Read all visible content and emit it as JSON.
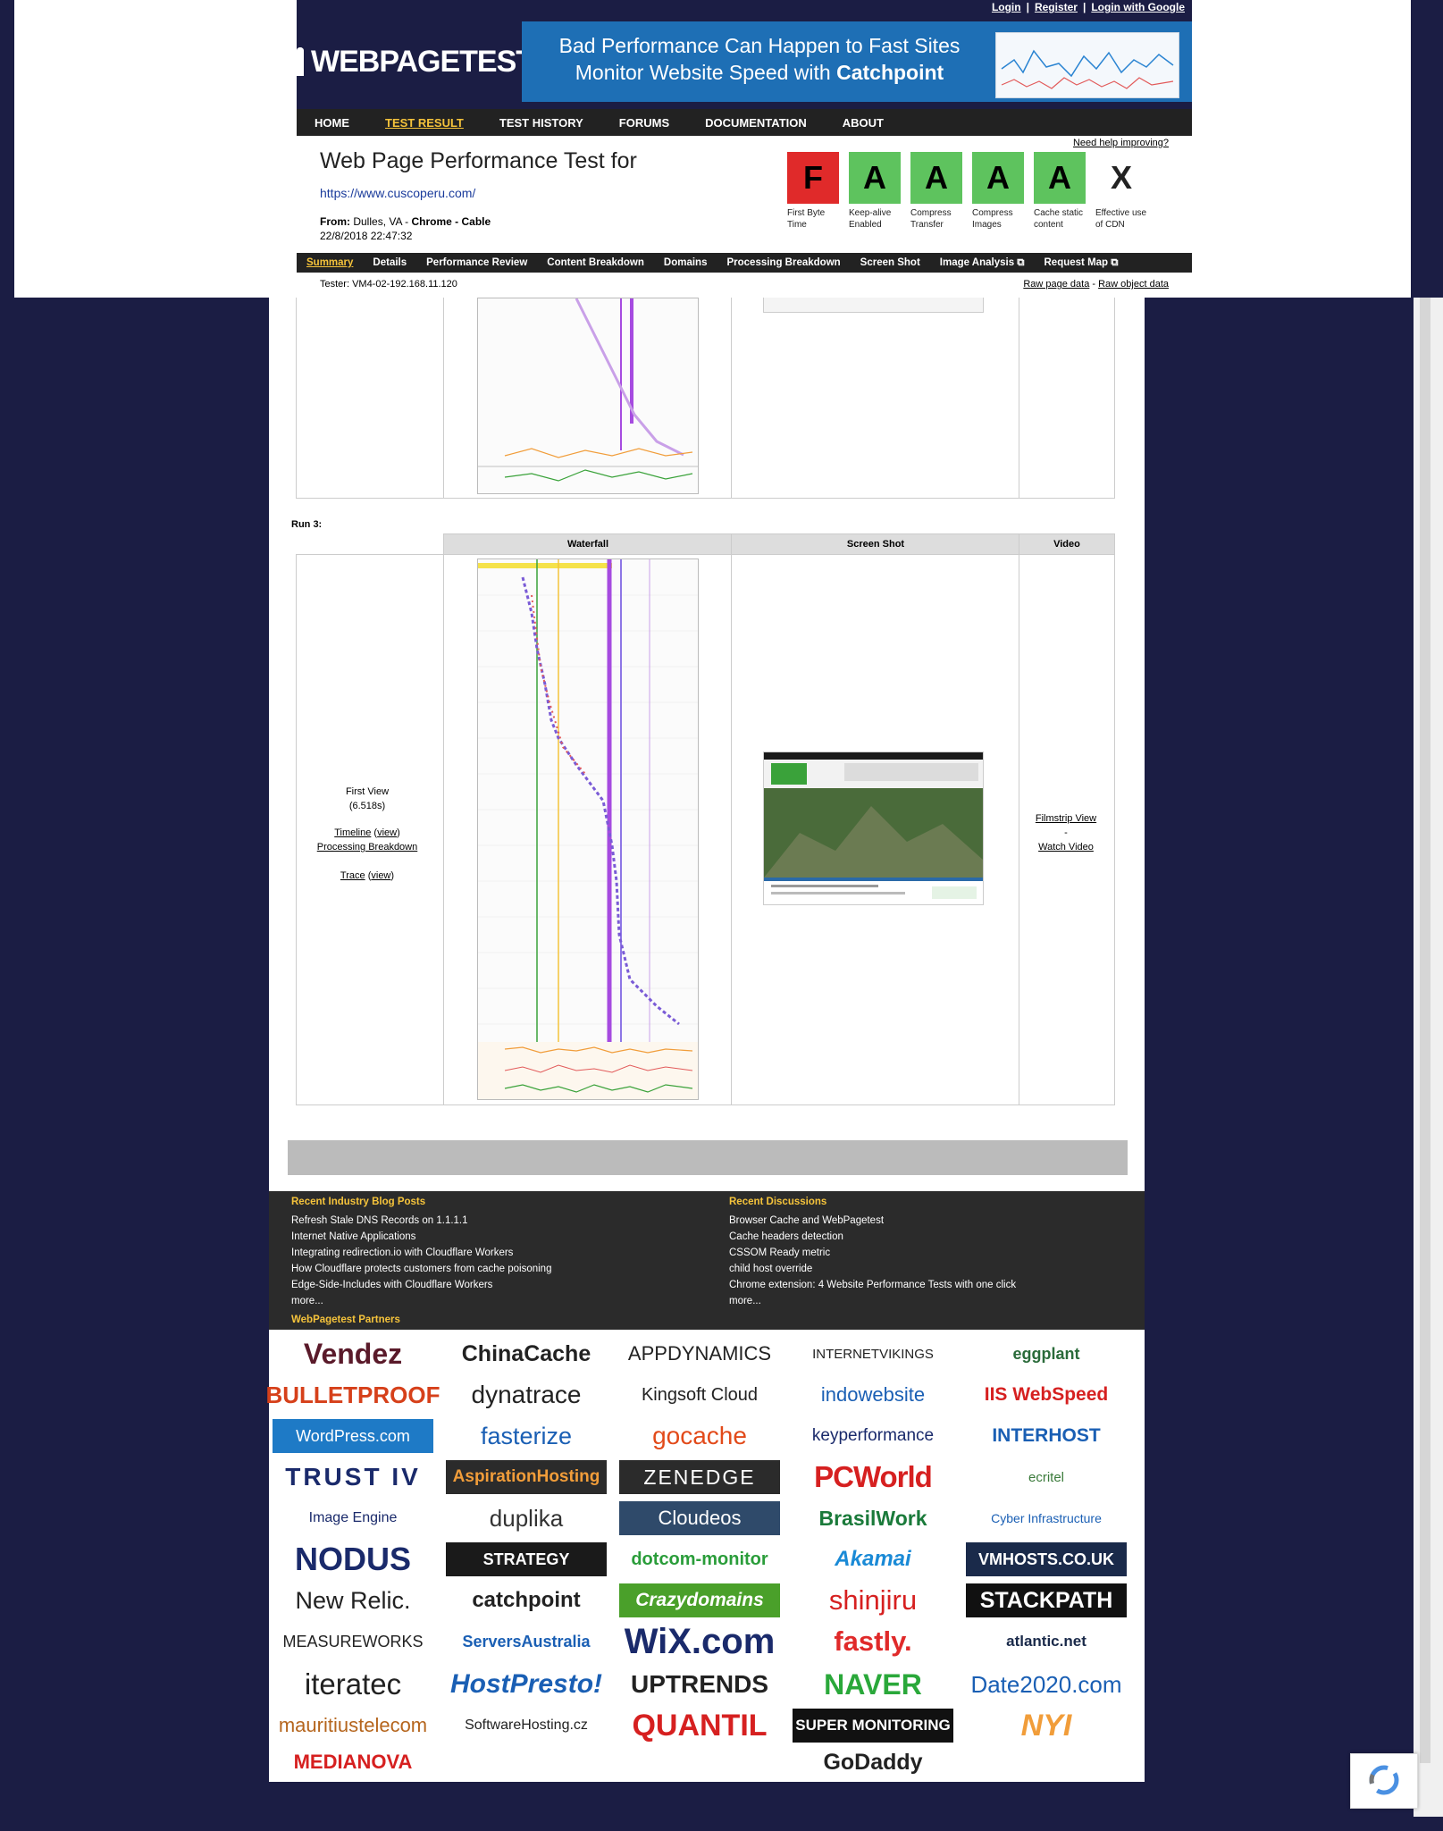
{
  "top_links": {
    "login": "Login",
    "register": "Register",
    "login_google": "Login with Google",
    "sep": "|"
  },
  "logo": {
    "text": "WEBPAGETEST"
  },
  "banner": {
    "line1": "Bad Performance Can Happen to Fast Sites",
    "line2_prefix": "Monitor Website Speed with ",
    "line2_brand": "Catchpoint"
  },
  "menu": [
    "HOME",
    "TEST RESULT",
    "TEST HISTORY",
    "FORUMS",
    "DOCUMENTATION",
    "ABOUT"
  ],
  "header": {
    "title": "Web Page Performance Test for",
    "url": "https://www.cuscoperu.com/",
    "from_label": "From: ",
    "from_loc": "Dulles, VA - ",
    "from_browser": "Chrome - Cable",
    "datetime": "22/8/2018 22:47:32",
    "help": "Need help improving?",
    "tester": "Tester: VM4-02-192.168.11.120",
    "raw_page": "Raw page data",
    "raw_dash": " - ",
    "raw_object": "Raw object data"
  },
  "grades": [
    {
      "grade": "F",
      "label": "First Byte Time",
      "color": "#e02a2a"
    },
    {
      "grade": "A",
      "label": "Keep-alive Enabled",
      "color": "#5ec35e"
    },
    {
      "grade": "A",
      "label": "Compress Transfer",
      "color": "#5ec35e"
    },
    {
      "grade": "A",
      "label": "Compress Images",
      "color": "#5ec35e"
    },
    {
      "grade": "A",
      "label": "Cache static content",
      "color": "#5ec35e"
    },
    {
      "grade": "X",
      "label": "Effective use of CDN",
      "color": "#ffffff"
    }
  ],
  "tabs": [
    "Summary",
    "Details",
    "Performance Review",
    "Content Breakdown",
    "Domains",
    "Processing Breakdown",
    "Screen Shot",
    "Image Analysis ⧉",
    "Request Map ⧉"
  ],
  "run3": {
    "label": "Run 3:",
    "col_waterfall": "Waterfall",
    "col_screenshot": "Screen Shot",
    "col_video": "Video",
    "first_view": "First View",
    "time": "(6.518s)",
    "timeline": "Timeline",
    "view1": "view",
    "processing": "Processing Breakdown",
    "trace": "Trace",
    "view2": "view",
    "filmstrip": "Filmstrip View",
    "dash": "-",
    "watch": "Watch Video"
  },
  "footer": {
    "blog_title": "Recent Industry Blog Posts",
    "blog_items": [
      "Refresh Stale DNS Records on 1.1.1.1",
      "Internet Native Applications",
      "Integrating redirection.io with Cloudflare Workers",
      "How Cloudflare protects customers from cache poisoning",
      "Edge-Side-Includes with Cloudflare Workers",
      "more..."
    ],
    "disc_title": "Recent Discussions",
    "disc_items": [
      "Browser Cache and WebPagetest",
      "Cache headers detection",
      "CSSOM Ready metric",
      "child host override",
      "Chrome extension: 4 Website Performance Tests with one click",
      "more..."
    ],
    "partners_title": "WebPagetest Partners"
  },
  "partners": [
    "Vendez",
    "ChinaCache",
    "APPDYNAMICS",
    "INTERNETVIKINGS",
    "eggplant",
    "BULLETPROOF",
    "dynatrace",
    "Kingsoft Cloud",
    "indowebsite",
    "IIS WebSpeed",
    "WordPress.com",
    "fasterize",
    "gocache",
    "keyperformance",
    "INTERHOST",
    "TRUST IV",
    "AspirationHosting",
    "ZENEDGE",
    "PCWorld",
    "ecritel",
    "Image Engine",
    "duplika",
    "Cloudeos",
    "BrasilWork",
    "Cyber Infrastructure",
    "NODUS",
    "STRATEGY",
    "dotcom-monitor",
    "Akamai",
    "VMHOSTS.CO.UK",
    "New Relic.",
    "catchpoint",
    "Crazydomains",
    "shinjiru",
    "STACKPATH",
    "MEASUREWORKS",
    "ServersAustralia",
    "WiX.com",
    "fastly.",
    "atlantic.net",
    "iteratec",
    "HostPresto!",
    "UPTRENDS",
    "NAVER",
    "Date2020.com",
    "mauritiustelecom",
    "SoftwareHosting.cz",
    "QUANTIL",
    "SUPER MONITORING",
    "NYI",
    "MEDIANOVA",
    "GoDaddy"
  ],
  "partner_colors": {
    "red": "#d62020",
    "blue": "#1a5fb4",
    "dark": "#222222",
    "green": "#2a9d3a"
  }
}
